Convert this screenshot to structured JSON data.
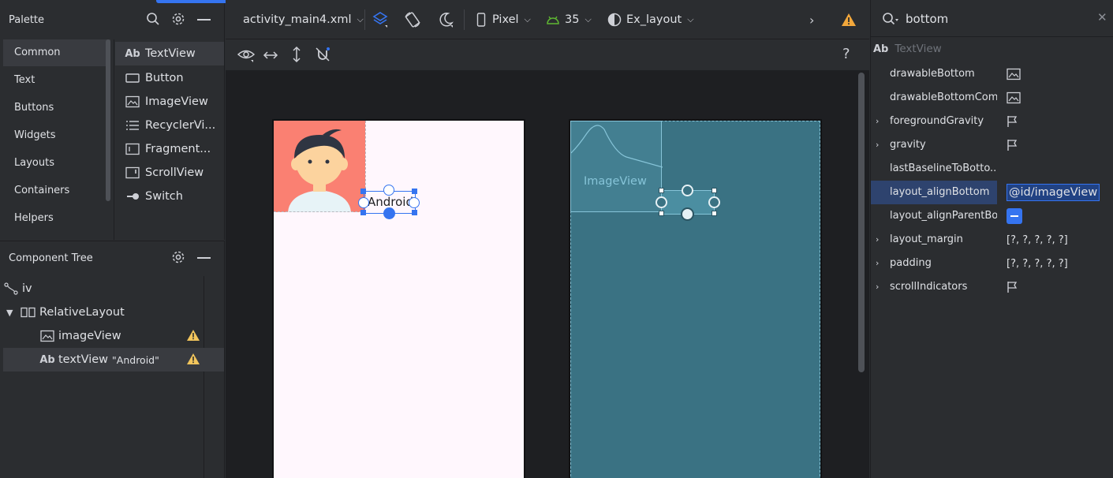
{
  "palette": {
    "title": "Palette",
    "categories": [
      "Common",
      "Text",
      "Buttons",
      "Widgets",
      "Layouts",
      "Containers",
      "Helpers"
    ],
    "items": [
      "TextView",
      "Button",
      "ImageView",
      "RecyclerVi...",
      "Fragment...",
      "ScrollView",
      "Switch"
    ]
  },
  "tree": {
    "title": "Component Tree",
    "rows": [
      {
        "label": "iv"
      },
      {
        "label": "RelativeLayout"
      },
      {
        "label": "imageView"
      },
      {
        "label": "textView",
        "tag": "\"Android\""
      }
    ]
  },
  "toolbar": {
    "file": "activity_main4.xml",
    "device": "Pixel",
    "api": "35",
    "theme": "Ex_layout"
  },
  "design": {
    "text_view_text": "Android",
    "blueprint_label": "ImageView"
  },
  "attributes": {
    "search_value": "bottom",
    "widget_type": "TextView",
    "rows": [
      {
        "name": "drawableBottom",
        "value": ""
      },
      {
        "name": "drawableBottomCom...",
        "value": ""
      },
      {
        "name": "foregroundGravity",
        "value": ""
      },
      {
        "name": "gravity",
        "value": ""
      },
      {
        "name": "lastBaselineToBotto...",
        "value": ""
      },
      {
        "name": "layout_alignBottom",
        "value": "@id/imageView"
      },
      {
        "name": "layout_alignParentBo...",
        "value": ""
      },
      {
        "name": "layout_margin",
        "value": "[?, ?, ?, ?, ?]"
      },
      {
        "name": "padding",
        "value": "[?, ?, ?, ?, ?]"
      },
      {
        "name": "scrollIndicators",
        "value": ""
      }
    ]
  },
  "colors": {
    "accent": "#3574f0",
    "warning": "#f2c55c",
    "blueprint": "#3a7283",
    "avatar_bg": "#fa8072"
  }
}
